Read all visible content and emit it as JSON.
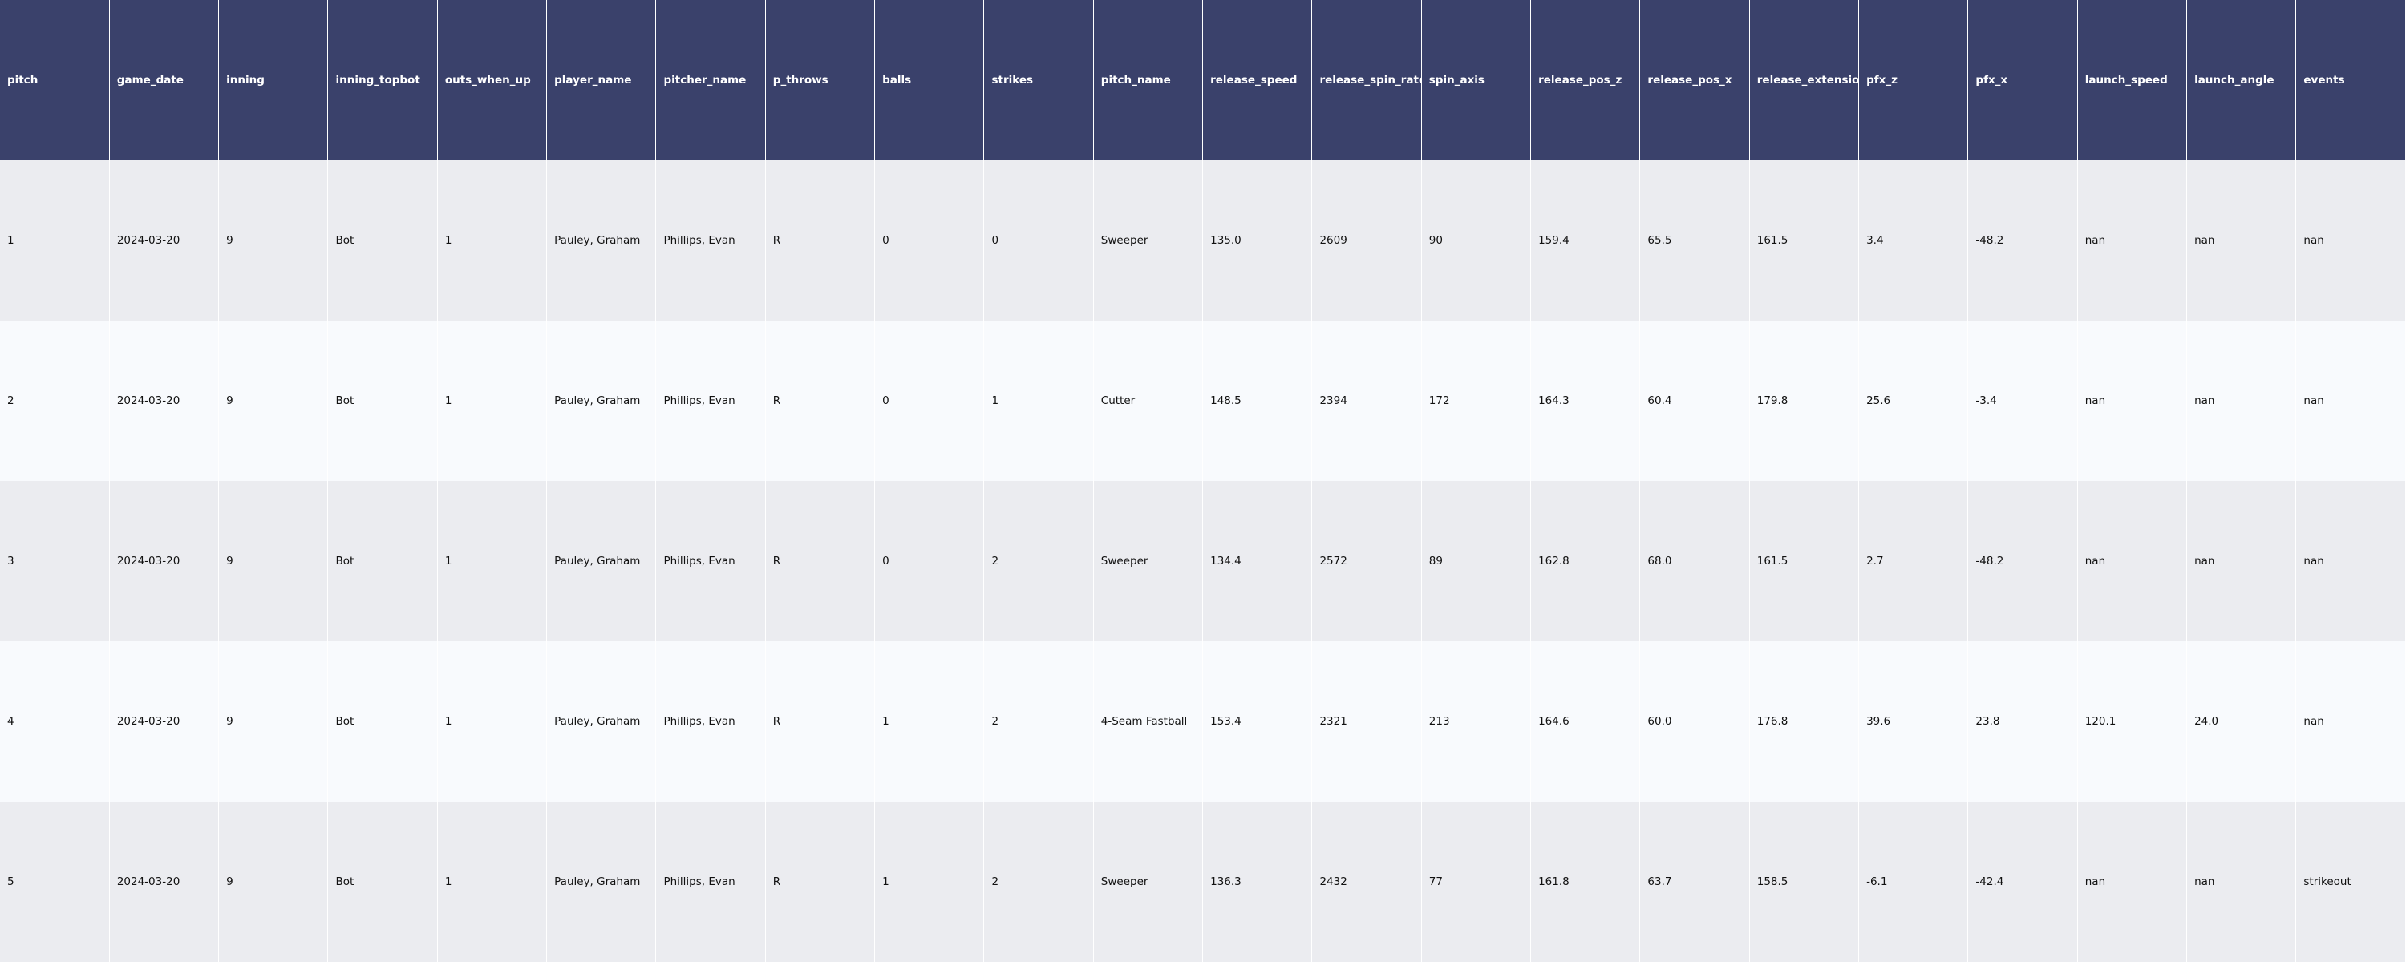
{
  "columns": [
    "pitch",
    "game_date",
    "inning",
    "inning_topbot",
    "outs_when_up",
    "player_name",
    "pitcher_name",
    "p_throws",
    "balls",
    "strikes",
    "pitch_name",
    "release_speed",
    "release_spin_rate",
    "spin_axis",
    "release_pos_z",
    "release_pos_x",
    "release_extension",
    "pfx_z",
    "pfx_x",
    "launch_speed",
    "launch_angle",
    "events"
  ],
  "rows": [
    [
      "1",
      "2024-03-20",
      "9",
      "Bot",
      "1",
      "Pauley, Graham",
      "Phillips, Evan",
      "R",
      "0",
      "0",
      "Sweeper",
      "135.0",
      "2609",
      "90",
      "159.4",
      "65.5",
      "161.5",
      "3.4",
      "-48.2",
      "nan",
      "nan",
      "nan"
    ],
    [
      "2",
      "2024-03-20",
      "9",
      "Bot",
      "1",
      "Pauley, Graham",
      "Phillips, Evan",
      "R",
      "0",
      "1",
      "Cutter",
      "148.5",
      "2394",
      "172",
      "164.3",
      "60.4",
      "179.8",
      "25.6",
      "-3.4",
      "nan",
      "nan",
      "nan"
    ],
    [
      "3",
      "2024-03-20",
      "9",
      "Bot",
      "1",
      "Pauley, Graham",
      "Phillips, Evan",
      "R",
      "0",
      "2",
      "Sweeper",
      "134.4",
      "2572",
      "89",
      "162.8",
      "68.0",
      "161.5",
      "2.7",
      "-48.2",
      "nan",
      "nan",
      "nan"
    ],
    [
      "4",
      "2024-03-20",
      "9",
      "Bot",
      "1",
      "Pauley, Graham",
      "Phillips, Evan",
      "R",
      "1",
      "2",
      "4-Seam Fastball",
      "153.4",
      "2321",
      "213",
      "164.6",
      "60.0",
      "176.8",
      "39.6",
      "23.8",
      "120.1",
      "24.0",
      "nan"
    ],
    [
      "5",
      "2024-03-20",
      "9",
      "Bot",
      "1",
      "Pauley, Graham",
      "Phillips, Evan",
      "R",
      "1",
      "2",
      "Sweeper",
      "136.3",
      "2432",
      "77",
      "161.8",
      "63.7",
      "158.5",
      "-6.1",
      "-42.4",
      "nan",
      "nan",
      "strikeout"
    ]
  ],
  "colors": {
    "header_bg": "#3a416b",
    "header_text": "#ffffff",
    "row_odd_bg": "#ebecf0",
    "row_even_bg": "#f8fafd"
  }
}
